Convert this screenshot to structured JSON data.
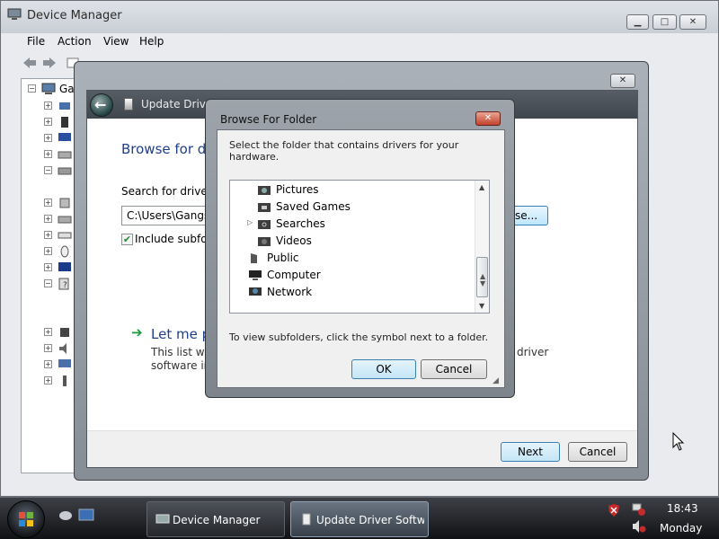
{
  "device_manager": {
    "title": "Device Manager",
    "menu": [
      "File",
      "Action",
      "View",
      "Help"
    ],
    "tree_root": "Gar",
    "window_controls": {
      "minimize": "▁",
      "maximize": "□",
      "close": "✕"
    }
  },
  "update_driver": {
    "header_title": "Update Driver",
    "heading": "Browse for dr",
    "search_label": "Search for driver s",
    "path_value": "C:\\Users\\Gangst",
    "browse_label": "se...",
    "include_subfolders_label": "Include subfol",
    "include_subfolders_checked": true,
    "let_me_title": "Let me p",
    "let_me_desc_1": "This list will",
    "let_me_desc_2": "software in",
    "let_me_desc_right_1": "driver",
    "next_label": "Next",
    "cancel_label": "Cancel",
    "close": "✕"
  },
  "browse_folder": {
    "title": "Browse For Folder",
    "instruction": "Select the folder that contains drivers for your hardware.",
    "folders": [
      {
        "label": "Pictures",
        "indent": 1,
        "icon": "pictures-folder-icon",
        "expandable": false
      },
      {
        "label": "Saved Games",
        "indent": 1,
        "icon": "saved-games-folder-icon",
        "expandable": false
      },
      {
        "label": "Searches",
        "indent": 1,
        "icon": "searches-folder-icon",
        "expandable": true
      },
      {
        "label": "Videos",
        "indent": 1,
        "icon": "videos-folder-icon",
        "expandable": false
      },
      {
        "label": "Public",
        "indent": 0,
        "icon": "public-folder-icon",
        "expandable": false
      },
      {
        "label": "Computer",
        "indent": 0,
        "icon": "computer-icon",
        "expandable": false
      },
      {
        "label": "Network",
        "indent": 0,
        "icon": "network-icon",
        "expandable": false
      }
    ],
    "hint": "To view subfolders, click the symbol next to a folder.",
    "ok_label": "OK",
    "cancel_label": "Cancel",
    "close": "✕"
  },
  "taskbar": {
    "tasks": [
      {
        "label": "Device Manager",
        "active": false
      },
      {
        "label": "Update Driver Softw...",
        "active": true
      }
    ],
    "clock_time": "18:43",
    "clock_day": "Monday"
  },
  "colors": {
    "heading_blue": "#1e3f8a",
    "link_green": "#1b9a3a",
    "close_red": "#c3432b",
    "default_button_border": "#3c7fb1"
  }
}
